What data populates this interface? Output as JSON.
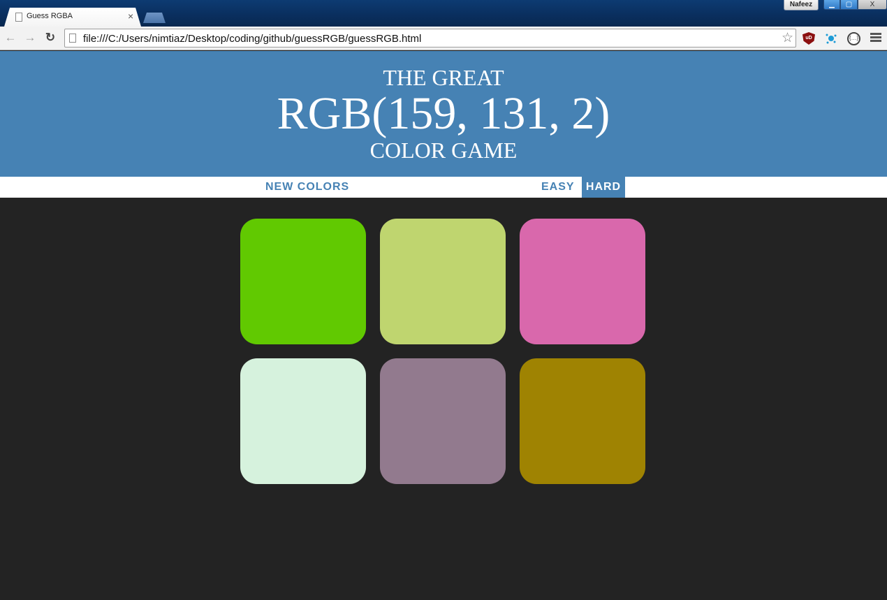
{
  "browser": {
    "tab_title": "Guess RGBA",
    "tab_close": "×",
    "profile_name": "Nafeez",
    "window_controls": {
      "minimize": "▁",
      "maximize": "▢",
      "close": "X"
    },
    "url": "file:///C:/Users/nimtiaz/Desktop/coding/github/guessRGB/guessRGB.html",
    "nav": {
      "back": "←",
      "forward": "→",
      "reload": "↻"
    },
    "bookmark_star": "☆",
    "ext_ublock_label": "uD",
    "ext_circle_label": "{…}"
  },
  "header": {
    "line1": "THE GREAT",
    "rgb_display": "RGB(159, 131, 2)",
    "line3": "COLOR GAME",
    "background": "#4682b4"
  },
  "stripe": {
    "new_colors": "NEW COLORS",
    "message": "",
    "easy": "EASY",
    "hard": "HARD",
    "selected_mode": "HARD"
  },
  "squares": [
    {
      "color": "rgb(97, 201, 1)"
    },
    {
      "color": "rgb(191, 213, 111)"
    },
    {
      "color": "rgb(217, 104, 172)"
    },
    {
      "color": "rgb(214, 242, 221)"
    },
    {
      "color": "rgb(146, 122, 142)"
    },
    {
      "color": "rgb(159, 131, 2)"
    }
  ],
  "colors": {
    "page_background": "#232323",
    "accent": "#4682b4"
  }
}
